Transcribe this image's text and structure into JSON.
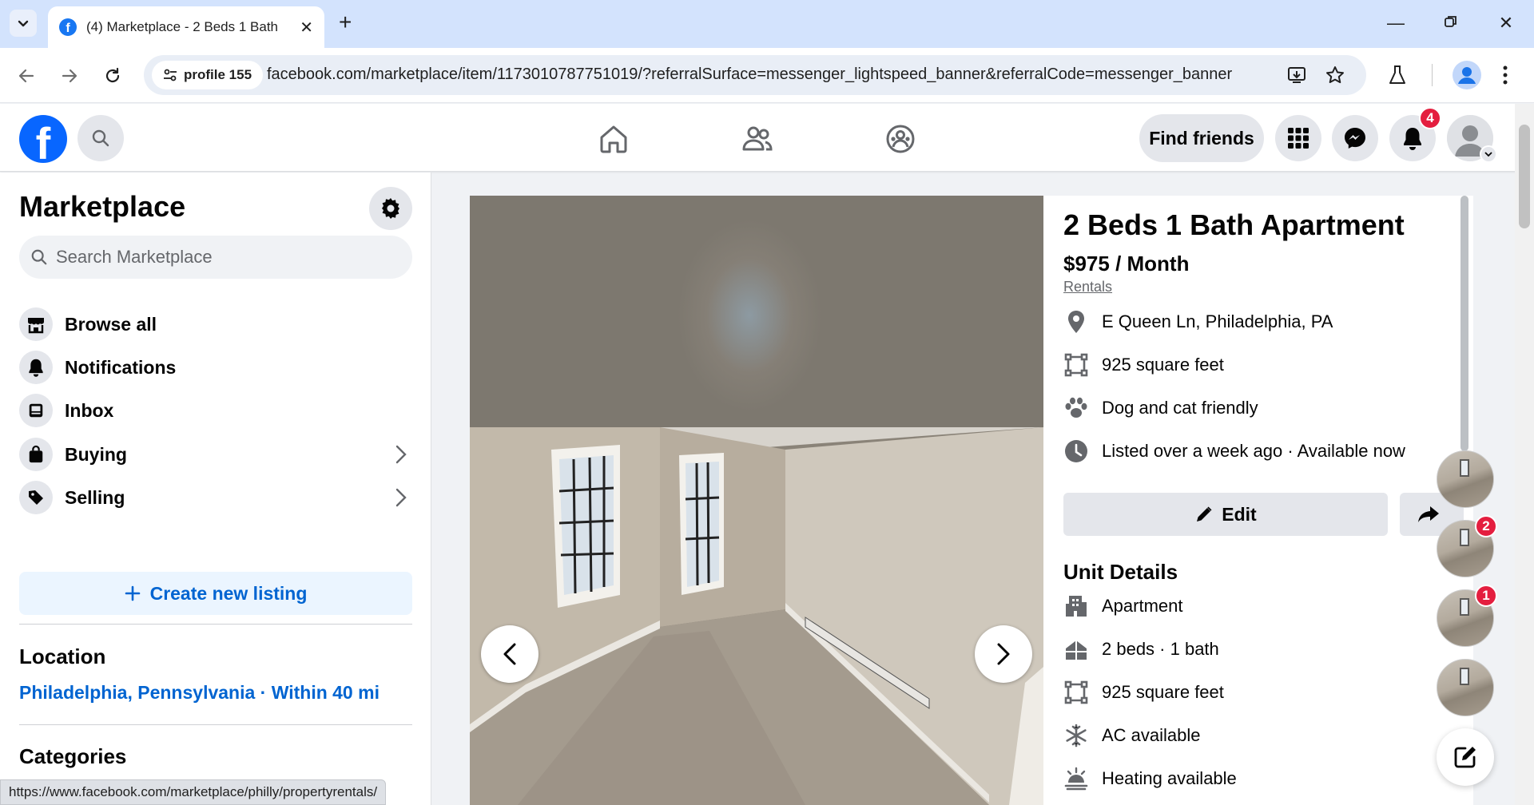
{
  "browser": {
    "tab_title": "(4) Marketplace - 2 Beds 1 Bath",
    "new_tab_symbol": "+",
    "site_chip": "profile 155",
    "url": "facebook.com/marketplace/item/1173010787751019/?referralSurface=messenger_lightspeed_banner&referralCode=messenger_banner",
    "status_url": "https://www.facebook.com/marketplace/philly/propertyrentals/",
    "accent": "#d3e3fd"
  },
  "fb_header": {
    "logo_letter": "f",
    "find_friends": "Find friends",
    "notification_count": "4",
    "brand_color": "#0866ff",
    "badge_color": "#e41e3f"
  },
  "sidebar": {
    "title": "Marketplace",
    "search_placeholder": "Search Marketplace",
    "items": [
      {
        "label": "Browse all",
        "icon": "storefront-icon"
      },
      {
        "label": "Notifications",
        "icon": "bell-icon"
      },
      {
        "label": "Inbox",
        "icon": "inbox-icon"
      },
      {
        "label": "Buying",
        "icon": "shopping-bag-icon"
      },
      {
        "label": "Selling",
        "icon": "price-tag-icon"
      }
    ],
    "create_listing": "Create new listing",
    "location_heading": "Location",
    "location_value": "Philadelphia, Pennsylvania · Within 40 mi",
    "categories_heading": "Categories"
  },
  "listing": {
    "title": "2 Beds 1 Bath Apartment",
    "price": "$975 / Month",
    "category": "Rentals",
    "facts": [
      {
        "text": "E Queen Ln, Philadelphia, PA",
        "icon": "location-pin-icon"
      },
      {
        "text": "925 square feet",
        "icon": "square-footage-icon"
      },
      {
        "text": "Dog and cat friendly",
        "icon": "paw-icon"
      },
      {
        "text": "Listed over a week ago · Available now",
        "icon": "clock-icon"
      }
    ],
    "edit_label": "Edit",
    "unit_details_heading": "Unit Details",
    "unit_details": [
      {
        "text": "Apartment",
        "icon": "building-icon"
      },
      {
        "text": "2 beds · 1 bath",
        "icon": "rooms-icon"
      },
      {
        "text": "925 square feet",
        "icon": "square-footage-icon"
      },
      {
        "text": "AC available",
        "icon": "snowflake-icon"
      },
      {
        "text": "Heating available",
        "icon": "heating-icon"
      }
    ]
  },
  "chat_heads": [
    {
      "badge": ""
    },
    {
      "badge": "2"
    },
    {
      "badge": "1"
    },
    {
      "badge": ""
    }
  ]
}
